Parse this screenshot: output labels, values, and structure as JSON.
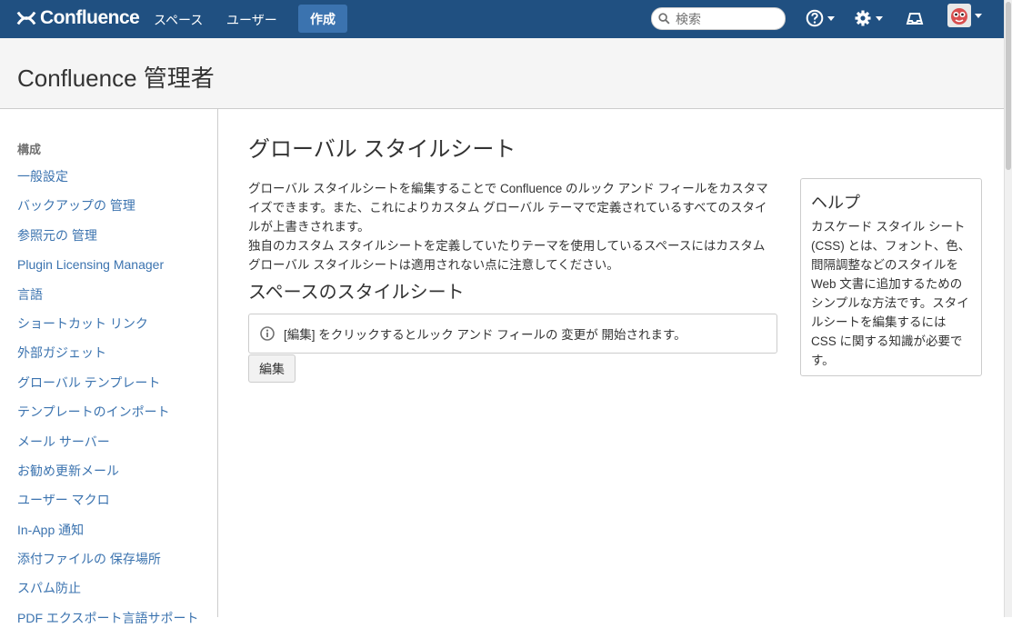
{
  "header": {
    "logo_text": "Confluence",
    "nav": [
      "スペース",
      "ユーザー"
    ],
    "create_label": "作成",
    "search_placeholder": "検索",
    "icons": [
      "help-icon",
      "gear-icon",
      "notifications-icon",
      "avatar"
    ]
  },
  "page_title": "Confluence 管理者",
  "sidebar": {
    "heading": "構成",
    "items": [
      "一般設定",
      "バックアップの 管理",
      "参照元の 管理",
      "Plugin Licensing Manager",
      "言語",
      "ショートカット リンク",
      "外部ガジェット",
      "グローバル テンプレート",
      "テンプレートのインポート",
      "メール サーバー",
      "お勧め更新メール",
      "ユーザー マクロ",
      "In-App 通知",
      "添付ファイルの 保存場所",
      "スパム防止",
      "PDF エクスポート言語サポート"
    ]
  },
  "main": {
    "title": "グローバル スタイルシート",
    "description_1": "グローバル スタイルシートを編集することで Confluence のルック アンド フィールをカスタマイズできます。また、これによりカスタム グローバル テーマで定義されているすべてのスタイルが上書きされます。",
    "description_2": "独自のカスタム スタイルシートを定義していたりテーマを使用しているスペースにはカスタム グローバル スタイルシートは適用されない点に注意してください。",
    "subheading": "スペースのスタイルシート",
    "info_text": "[編集] をクリックするとルック アンド フィールの 変更が 開始されます。",
    "edit_label": "編集"
  },
  "help": {
    "title": "ヘルプ",
    "body": "カスケード スタイル シート (CSS) とは、フォント、色、間隔調整などのスタイルを Web 文書に追加するためのシンプルな方法です。スタイルシートを編集するには CSS に関する知識が必要です。"
  },
  "colors": {
    "header_bg": "#205081",
    "create_bg": "#3b73af",
    "link": "#3b73af"
  }
}
